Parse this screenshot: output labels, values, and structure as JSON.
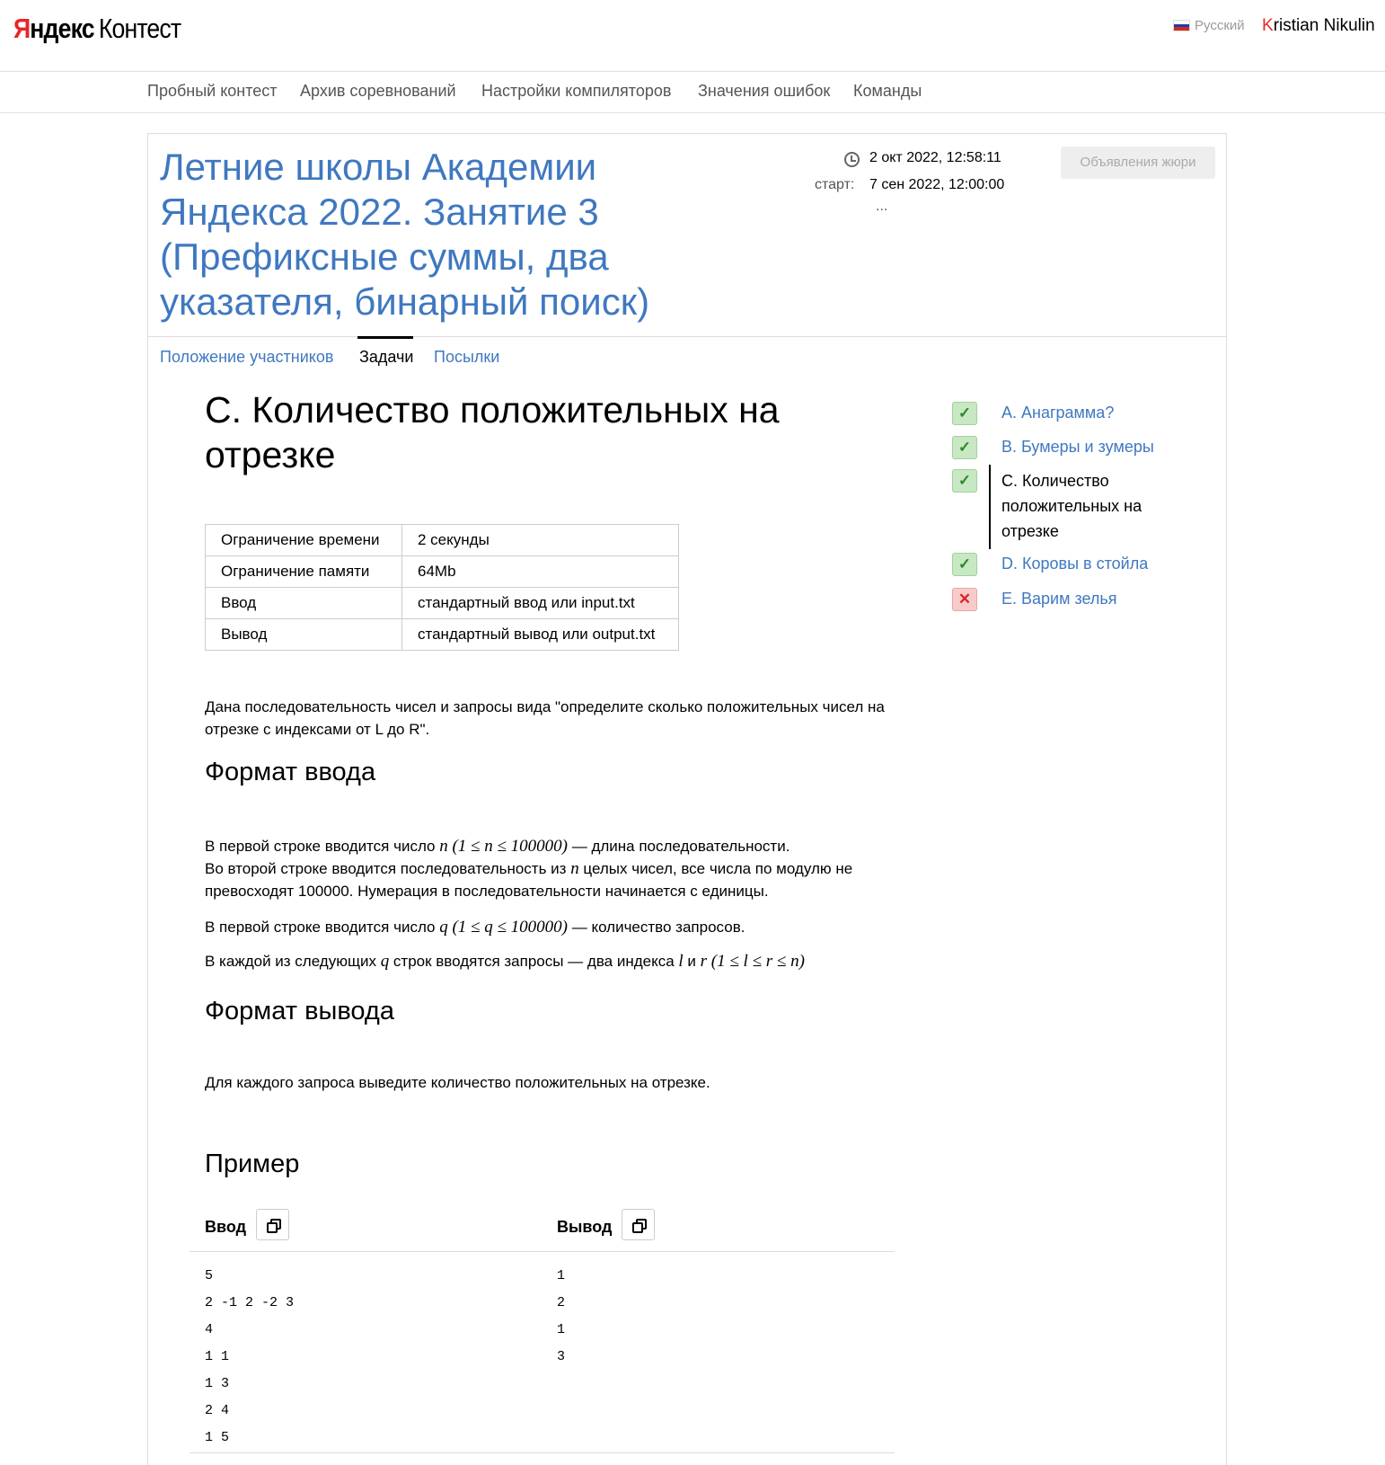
{
  "header": {
    "logo_ya": "Я",
    "logo_ndeks": "ндекс",
    "logo_kontest": "Контест",
    "language": "Русский",
    "user_first": "K",
    "user_rest": "ristian Nikulin"
  },
  "nav": [
    "Пробный контест",
    "Архив соревнований",
    "Настройки компиляторов",
    "Значения ошибок",
    "Команды"
  ],
  "contest": {
    "title": "Летние школы Академии Яндекса 2022. Занятие 3 (Префиксные суммы, два указателя, бинарный поиск)",
    "current_time": "2 окт 2022, 12:58:11",
    "start_label": "старт:",
    "start_time": "7 сен 2022, 12:00:00",
    "more": "...",
    "jury_button": "Объявления жюри",
    "tabs": [
      "Положение участников",
      "Задачи",
      "Посылки"
    ]
  },
  "problem": {
    "title": "C. Количество положительных на отрезке",
    "limits": [
      {
        "key": "Ограничение времени",
        "value": "2 секунды"
      },
      {
        "key": "Ограничение памяти",
        "value": "64Mb"
      },
      {
        "key": "Ввод",
        "value": "стандартный ввод или input.txt"
      },
      {
        "key": "Вывод",
        "value": "стандартный вывод или output.txt"
      }
    ],
    "statement": "Дана последовательность чисел и запросы вида \"определите сколько положительных чисел на отрезке с индексами от L до R\".",
    "input_heading": "Формат ввода",
    "input_p1_a": "В первой строке вводится число ",
    "input_p1_math": "n (1 ≤ n ≤ 100000)",
    "input_p1_b": " — длина последовательности.",
    "input_p2_a": "Во второй строке вводится последовательность из ",
    "input_p2_math": "n",
    "input_p2_b": " целых чисел, все числа по модулю не превосходят 100000. Нумерация в последовательности начинается с единицы.",
    "input_p3_a": "В первой строке вводится число ",
    "input_p3_math": "q (1 ≤ q ≤ 100000)",
    "input_p3_b": " — количество запросов.",
    "input_p4_a": "В каждой из следующих ",
    "input_p4_math1": "q",
    "input_p4_b": " строк вводятся запросы — два индекса ",
    "input_p4_math2": "l",
    "input_p4_c": " и ",
    "input_p4_math3": "r (1 ≤ l ≤ r ≤ n)",
    "output_heading": "Формат вывода",
    "output_text": "Для каждого запроса выведите количество положительных на отрезке.",
    "example_heading": "Пример",
    "example_input_label": "Ввод",
    "example_output_label": "Вывод",
    "example_input": "5\n2 -1 2 -2 3\n4\n1 1\n1 3\n2 4\n1 5",
    "example_output": "1\n2\n1\n3"
  },
  "sidebar": {
    "items": [
      {
        "label": "A. Анаграмма?",
        "status": "ok",
        "icon": "check-icon"
      },
      {
        "label": "B. Бумеры и зумеры",
        "status": "ok",
        "icon": "check-icon"
      },
      {
        "label": "C. Количество положительных на отрезке",
        "status": "ok",
        "icon": "check-icon"
      },
      {
        "label": "D. Коровы в стойла",
        "status": "ok",
        "icon": "check-icon"
      },
      {
        "label": "E. Варим зелья",
        "status": "bad",
        "icon": "cross-icon"
      }
    ]
  },
  "colors": {
    "link": "#3f78c0",
    "brand_red": "#e6262a",
    "ok": "#2c8a2c",
    "bad": "#d9242a"
  }
}
